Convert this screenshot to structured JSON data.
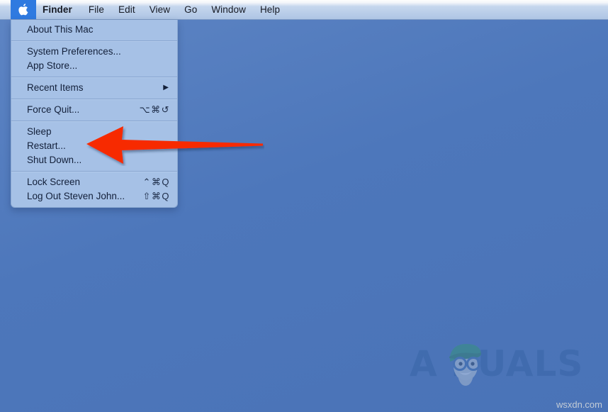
{
  "desktop": {
    "background_color": "#4d77bb"
  },
  "menubar": {
    "apple_icon": "apple-logo-icon",
    "highlight_color": "#2f7ae0",
    "items": [
      {
        "label": "Finder",
        "bold": true
      },
      {
        "label": "File",
        "bold": false
      },
      {
        "label": "Edit",
        "bold": false
      },
      {
        "label": "View",
        "bold": false
      },
      {
        "label": "Go",
        "bold": false
      },
      {
        "label": "Window",
        "bold": false
      },
      {
        "label": "Help",
        "bold": false
      }
    ]
  },
  "apple_menu": {
    "groups": [
      {
        "items": [
          {
            "label": "About This Mac",
            "shortcut": "",
            "submenu": false
          }
        ]
      },
      {
        "items": [
          {
            "label": "System Preferences...",
            "shortcut": "",
            "submenu": false
          },
          {
            "label": "App Store...",
            "shortcut": "",
            "submenu": false
          }
        ]
      },
      {
        "items": [
          {
            "label": "Recent Items",
            "shortcut": "",
            "submenu": true,
            "submenu_arrow": "▶"
          }
        ]
      },
      {
        "items": [
          {
            "label": "Force Quit...",
            "shortcut": "⌥⌘↺",
            "submenu": false
          }
        ]
      },
      {
        "items": [
          {
            "label": "Sleep",
            "shortcut": "",
            "submenu": false
          },
          {
            "label": "Restart...",
            "shortcut": "",
            "submenu": false
          },
          {
            "label": "Shut Down...",
            "shortcut": "",
            "submenu": false
          }
        ]
      },
      {
        "items": [
          {
            "label": "Lock Screen",
            "shortcut": "⌃⌘Q",
            "submenu": false
          },
          {
            "label": "Log Out Steven John...",
            "shortcut": "⇧⌘Q",
            "submenu": false
          }
        ]
      }
    ]
  },
  "annotation": {
    "arrow_color": "#f72b00",
    "points_to": "Restart..."
  },
  "watermark": {
    "text": "A  PUALS",
    "mascot": "appuals-mascot-icon",
    "color": "#2f5e9e"
  },
  "credit": {
    "text": "wsxdn.com"
  }
}
